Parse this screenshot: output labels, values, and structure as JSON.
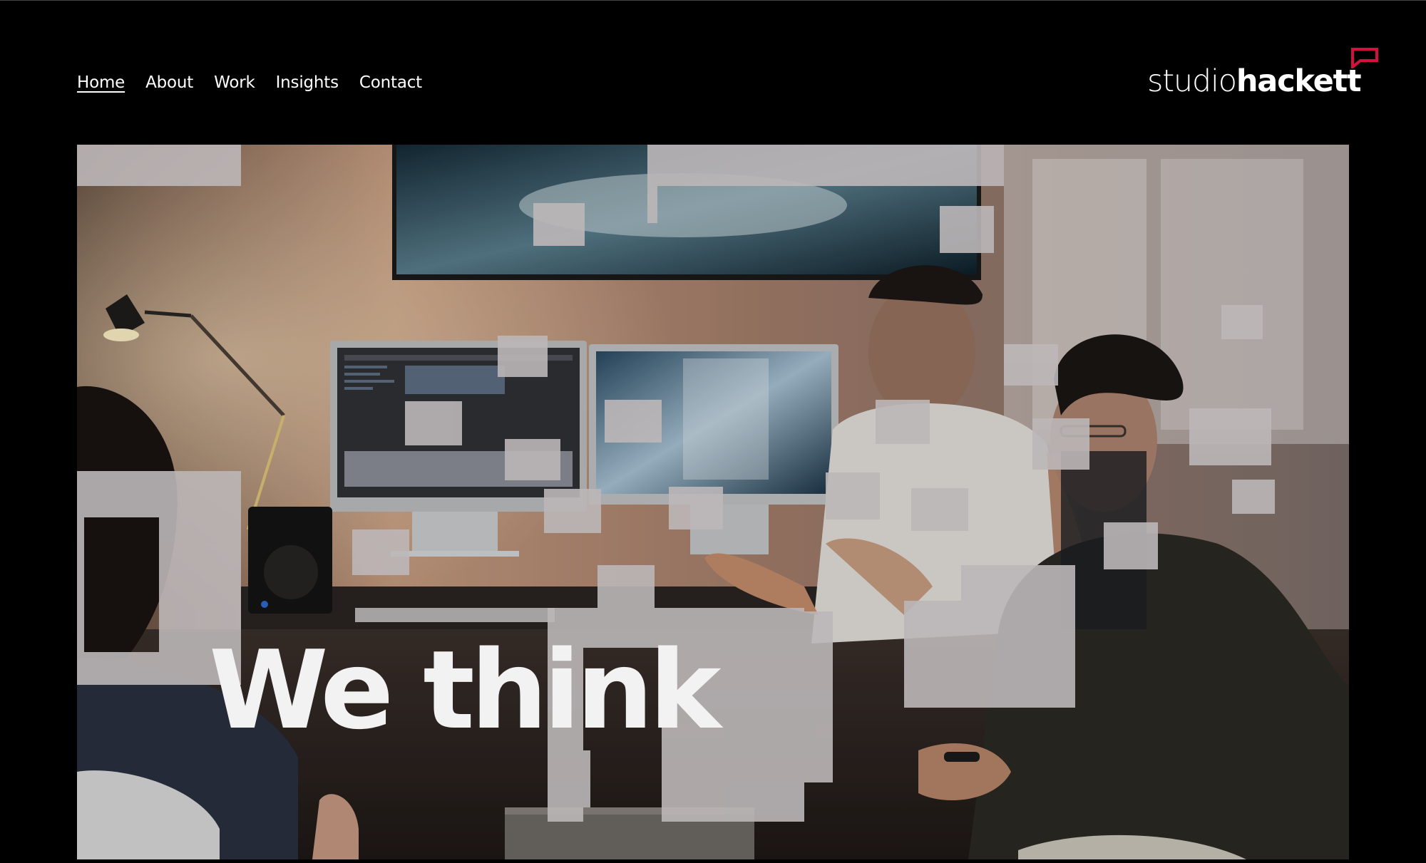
{
  "nav": {
    "items": [
      {
        "label": "Home",
        "active": true
      },
      {
        "label": "About",
        "active": false
      },
      {
        "label": "Work",
        "active": false
      },
      {
        "label": "Insights",
        "active": false
      },
      {
        "label": "Contact",
        "active": false
      }
    ]
  },
  "logo": {
    "text_light": "studio",
    "text_bold": "hackett",
    "mark_icon": "speech-bubble-icon",
    "accent_color": "#d4103c"
  },
  "hero": {
    "title": "We think",
    "image_description_icon": "team-meeting-photo"
  },
  "colors": {
    "background": "#000000",
    "text": "#ffffff",
    "overlay_squares": "#b9b4b6"
  }
}
